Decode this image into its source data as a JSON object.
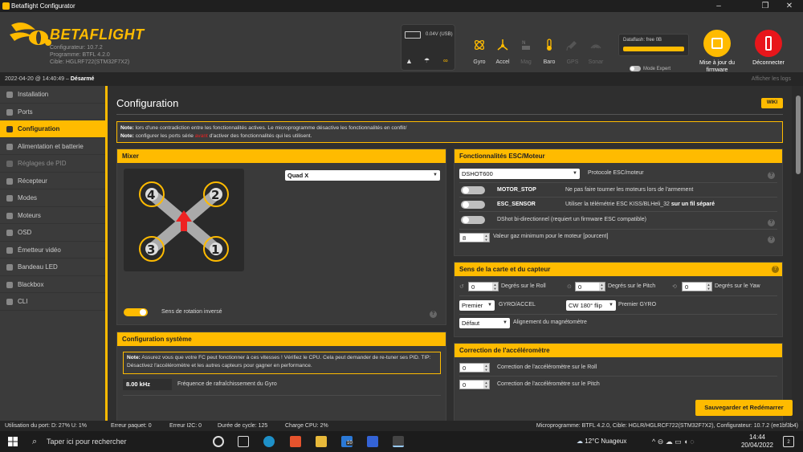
{
  "window": {
    "title": "Betaflight Configurator"
  },
  "header": {
    "brand": "BETAFLIGHT",
    "configurator": "Configurateur: 10.7.2",
    "firmware": "Programme: BTFL 4.2.0",
    "target": "Cible: HGLRF722(STM32F7X2)",
    "battery": "0.04V (USB)",
    "sensors": [
      {
        "name": "Gyro",
        "icon": "gyro-icon",
        "active": true
      },
      {
        "name": "Accel",
        "icon": "accel-icon",
        "active": true
      },
      {
        "name": "Mag",
        "icon": "mag-icon",
        "active": false
      },
      {
        "name": "Baro",
        "icon": "baro-icon",
        "active": true
      },
      {
        "name": "GPS",
        "icon": "gps-icon",
        "active": false
      },
      {
        "name": "Sonar",
        "icon": "sonar-icon",
        "active": false
      }
    ],
    "dataflash": "Dataflash: free 0B",
    "expert_mode": "Mode Expert",
    "update_firmware": "Mise à jour du firmware",
    "disconnect": "Déconnecter"
  },
  "statusline": {
    "datetime": "2022-04-20 @ 14:40:49",
    "separator": "–",
    "state": "Désarmé",
    "show_logs": "Afficher les logs"
  },
  "sidebar": {
    "items": [
      {
        "label": "Installation",
        "icon": "wrench-icon"
      },
      {
        "label": "Ports",
        "icon": "plug-icon"
      },
      {
        "label": "Configuration",
        "icon": "gear-icon",
        "active": true
      },
      {
        "label": "Alimentation et batterie",
        "icon": "battery-icon"
      },
      {
        "label": "Réglages de PID",
        "icon": "sliders-icon",
        "dim": true
      },
      {
        "label": "Récepteur",
        "icon": "receiver-icon"
      },
      {
        "label": "Modes",
        "icon": "modes-icon"
      },
      {
        "label": "Moteurs",
        "icon": "motor-icon"
      },
      {
        "label": "OSD",
        "icon": "osd-icon"
      },
      {
        "label": "Émetteur vidéo",
        "icon": "video-tx-icon"
      },
      {
        "label": "Bandeau LED",
        "icon": "led-icon"
      },
      {
        "label": "Blackbox",
        "icon": "blackbox-icon"
      },
      {
        "label": "CLI",
        "icon": "cli-icon"
      }
    ]
  },
  "main": {
    "title": "Configuration",
    "wiki": "WIKI",
    "note1_label": "Note:",
    "note1_text": "lors d'une contradiction entre les fonctionnalités actives. Le microprogramme désactive les fonctionnalités en conflit/",
    "note2_label": "Note:",
    "note2_a": "configurer les ports série",
    "note2_red": "avant",
    "note2_b": "d'activer des fonctionnalités qui les utilisent.",
    "mixer": {
      "title": "Mixer",
      "type": "Quad X",
      "motors": [
        "4",
        "2",
        "3",
        "1"
      ],
      "reverse_label": "Sens de rotation inversé",
      "reverse_on": true
    },
    "system": {
      "title": "Configuration système",
      "note_label": "Note:",
      "note_text": "Assurez vous que votre FC peut fonctionner à ces vitesses ! Vérifiez le CPU. Cela peut demander de re-tuner ses PID. TIP: Désactivez l'accéléromètre et les autres capteurs pour gagner en performance.",
      "gyro_freq": "8.00 kHz",
      "gyro_freq_label": "Fréquence de rafraîchissement du Gyro"
    },
    "esc": {
      "title": "Fonctionnalités ESC/Moteur",
      "protocol": "DSHOT600",
      "protocol_label": "Protocole ESC/moteur",
      "motor_stop": "MOTOR_STOP",
      "motor_stop_desc": "Ne pas faire tourner les moteurs lors de l'armement",
      "esc_sensor": "ESC_SENSOR",
      "esc_sensor_desc": "Utiliser la télémétrie ESC KISS/BLHeli_32",
      "esc_sensor_desc_bold": "sur un fil séparé",
      "dshot_bidir": "DShot bi-directionnel (requiert un firmware ESC compatible)",
      "min_throttle": "8",
      "min_throttle_label": "Valeur gaz minimum pour le moteur [pourcent]"
    },
    "board": {
      "title": "Sens de la carte et du capteur",
      "roll": "0",
      "roll_label": "Degrés sur le Roll",
      "pitch": "0",
      "pitch_label": "Degrés sur le Pitch",
      "yaw": "0",
      "yaw_label": "Degrés sur le Yaw",
      "gyro_sel": "Premier",
      "gyro_sel_label": "GYRO/ACCEL",
      "gyro_align": "CW 180° flip",
      "gyro_align_label": "Premier GYRO",
      "mag_align": "Défaut",
      "mag_align_label": "Alignement du magnétomètre"
    },
    "acc": {
      "title": "Correction de l'accéléromètre",
      "roll": "0",
      "roll_label": "Correction de l'accéléromètre sur le Roll",
      "pitch": "0",
      "pitch_label": "Correction de l'accéléromètre sur le Pitch"
    },
    "save": "Sauvegarder et Redémarrer"
  },
  "footer": {
    "port": "Utilisation du port: D: 27% U: 1%",
    "packet": "Erreur paquet: 0",
    "i2c": "Erreur I2C: 0",
    "cycle": "Durée de cycle: 125",
    "cpu": "Charge CPU: 2%",
    "version": "Microprogramme: BTFL 4.2.0, Cible: HGLR/HGLRCF722(STM32F7X2), Configurateur: 10.7.2 (ee1bf3b4)"
  },
  "taskbar": {
    "search": "Taper ici pour rechercher",
    "weather": "12°C Nuageux",
    "time": "14:44",
    "date": "20/04/2022",
    "badge_mail": "10",
    "badge_app": "10",
    "notif": "2"
  },
  "colors": {
    "accent": "#ffbb00",
    "disconnect": "#e8161b"
  }
}
